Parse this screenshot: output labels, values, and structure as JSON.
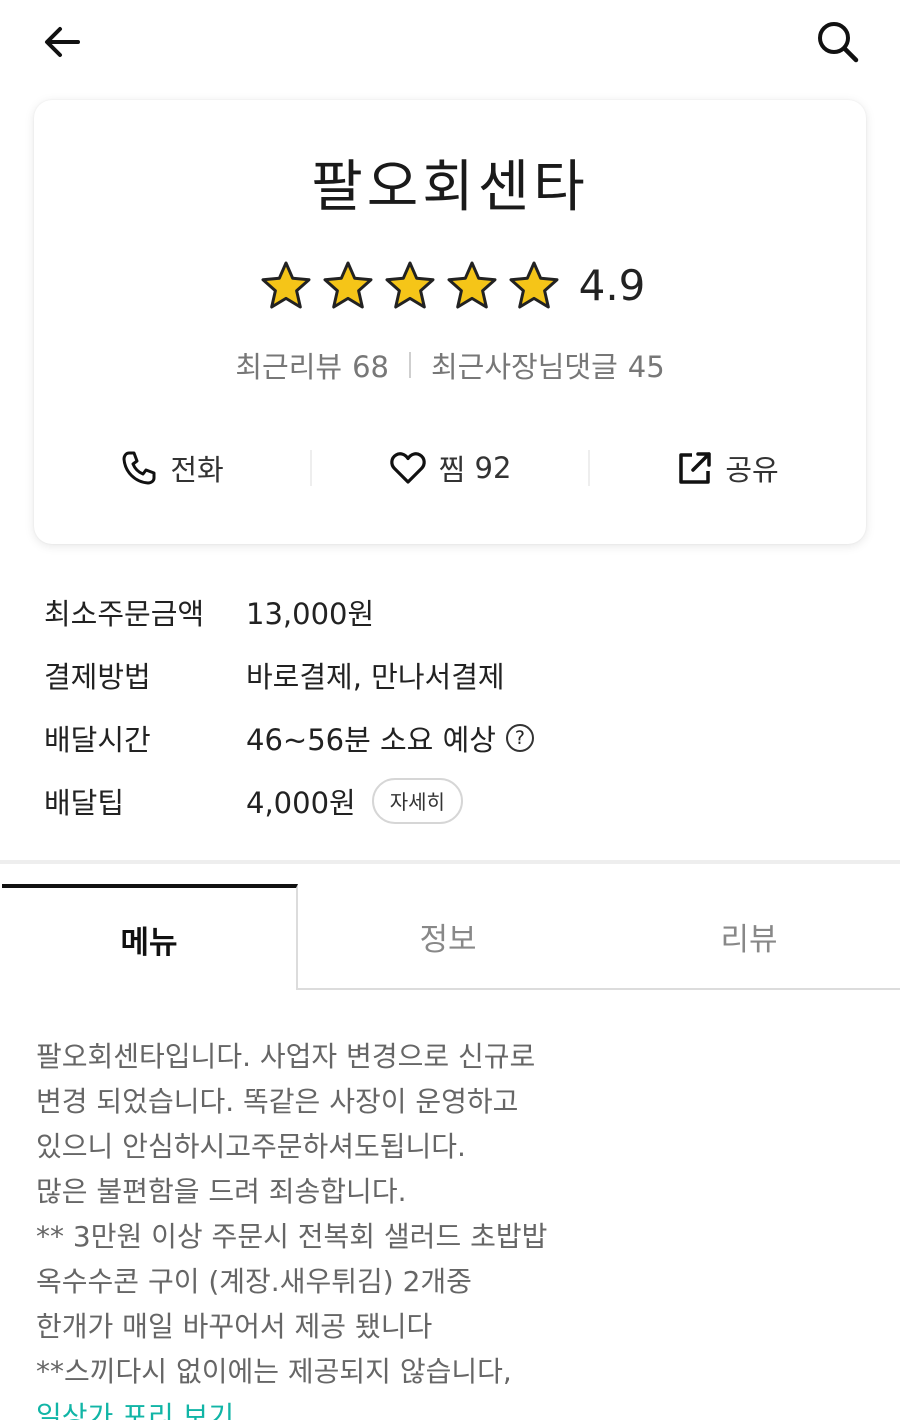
{
  "header": {
    "back_icon": "back-arrow-icon",
    "search_icon": "search-icon"
  },
  "store": {
    "name": "팔오회센타",
    "rating": "4.9",
    "rating_stars": 5,
    "recent_reviews_label": "최근리뷰",
    "recent_reviews_count": "68",
    "owner_comments_label": "최근사장님댓글",
    "owner_comments_count": "45",
    "star_color": "#f5c518"
  },
  "actions": {
    "call_label": "전화",
    "like_label": "찜",
    "like_count": "92",
    "share_label": "공유"
  },
  "info": {
    "min_order_label": "최소주문금액",
    "min_order_value": "13,000원",
    "payment_label": "결제방법",
    "payment_value": "바로결제, 만나서결제",
    "delivery_time_label": "배달시간",
    "delivery_time_value": "46~56분 소요 예상",
    "help_mark": "?",
    "delivery_tip_label": "배달팁",
    "delivery_tip_value": "4,000원",
    "detail_button": "자세히"
  },
  "tabs": [
    {
      "label": "메뉴",
      "active": true
    },
    {
      "label": "정보",
      "active": false
    },
    {
      "label": "리뷰",
      "active": false
    }
  ],
  "description": {
    "lines": [
      "팔오회센타입니다. 사업자 변경으로 신규로",
      "변경 되었습니다. 똑같은 사장이 운영하고",
      "있으니 안심하시고주문하셔도됩니다.",
      "많은 불편함을 드려 죄송합니다.",
      "** 3만원 이상 주문시 전복회 샐러드 초밥밥",
      "옥수수콘 구이 (계장.새우튀김) 2개중",
      "한개가 매일 바꾸어서 제공 됐니다",
      "**스끼다시 없이에는 제공되지 않습니다,"
    ],
    "link": "일상가 포리 보기",
    "link_color": "#11b5a6"
  }
}
